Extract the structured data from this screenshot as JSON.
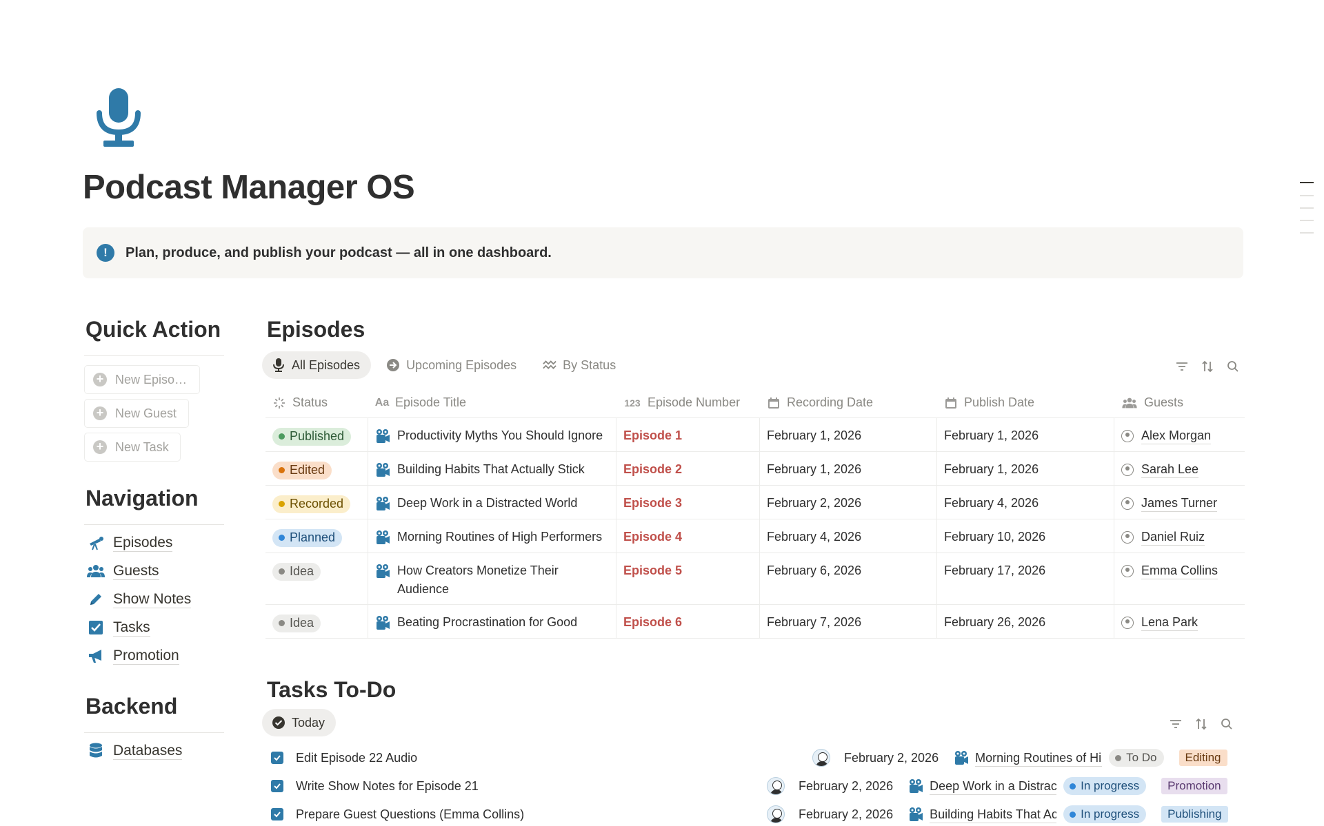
{
  "page": {
    "icon": "microphone-icon",
    "title": "Podcast Manager OS",
    "callout": "Plan, produce, and publish your podcast — all in one dashboard.",
    "callout_icon": "exclamation-bubble-icon"
  },
  "sidebar": {
    "quick_action_title": "Quick Action",
    "quick_actions": [
      {
        "label": "New Episo…",
        "icon": "plus-circle-icon"
      },
      {
        "label": "New Guest",
        "icon": "plus-circle-icon"
      },
      {
        "label": "New Task",
        "icon": "plus-circle-icon"
      }
    ],
    "navigation_title": "Navigation",
    "navigation": [
      {
        "label": "Episodes",
        "icon": "telescope-icon"
      },
      {
        "label": "Guests",
        "icon": "people-icon"
      },
      {
        "label": "Show Notes",
        "icon": "pencil-icon"
      },
      {
        "label": "Tasks",
        "icon": "checkbox-icon"
      },
      {
        "label": "Promotion",
        "icon": "megaphone-icon"
      }
    ],
    "backend_title": "Backend",
    "backend": [
      {
        "label": "Databases",
        "icon": "database-icon"
      }
    ]
  },
  "episodes": {
    "title": "Episodes",
    "tabs": [
      {
        "label": "All Episodes",
        "icon": "microphone-icon",
        "active": true
      },
      {
        "label": "Upcoming Episodes",
        "icon": "arrow-circle-icon",
        "active": false
      },
      {
        "label": "By Status",
        "icon": "waves-icon",
        "active": false
      }
    ],
    "columns": [
      {
        "label": "Status",
        "icon": "status-icon"
      },
      {
        "label": "Episode Title",
        "icon": "text-icon"
      },
      {
        "label": "Episode Number",
        "icon": "number-icon"
      },
      {
        "label": "Recording Date",
        "icon": "calendar-icon"
      },
      {
        "label": "Publish Date",
        "icon": "calendar-icon"
      },
      {
        "label": "Guests",
        "icon": "people-icon"
      }
    ],
    "header_glyphs": {
      "text": "Aa",
      "number": "123"
    },
    "rows": [
      {
        "status": "Published",
        "title": "Productivity Myths You Should Ignore",
        "number": "Episode 1",
        "recording": "February 1, 2026",
        "publish": "February 1, 2026",
        "guest": "Alex Morgan"
      },
      {
        "status": "Edited",
        "title": "Building Habits That Actually Stick",
        "number": "Episode 2",
        "recording": "February 1, 2026",
        "publish": "February 1, 2026",
        "guest": "Sarah Lee"
      },
      {
        "status": "Recorded",
        "title": "Deep Work in a Distracted World",
        "number": "Episode 3",
        "recording": "February 2, 2026",
        "publish": "February 4, 2026",
        "guest": "James Turner"
      },
      {
        "status": "Planned",
        "title": "Morning Routines of High Performers",
        "number": "Episode 4",
        "recording": "February 4, 2026",
        "publish": "February 10, 2026",
        "guest": "Daniel Ruiz"
      },
      {
        "status": "Idea",
        "title": "How Creators Monetize Their Audience",
        "number": "Episode 5",
        "recording": "February 6, 2026",
        "publish": "February 17, 2026",
        "guest": "Emma Collins"
      },
      {
        "status": "Idea",
        "title": "Beating Procrastination for Good",
        "number": "Episode 6",
        "recording": "February 7, 2026",
        "publish": "February 26, 2026",
        "guest": "Lena Park"
      }
    ]
  },
  "status_colors": {
    "Published": {
      "bg": "#dbeddb",
      "dot": "#4b9b5e",
      "text": "#2d5a36"
    },
    "Edited": {
      "bg": "#fadec9",
      "dot": "#d9730d",
      "text": "#6a3b12"
    },
    "Recorded": {
      "bg": "#fbeecb",
      "dot": "#d9a300",
      "text": "#6b4f00"
    },
    "Planned": {
      "bg": "#d3e5f5",
      "dot": "#2f86d8",
      "text": "#1e4f7a"
    },
    "Idea": {
      "bg": "#ececea",
      "dot": "#8a8984",
      "text": "#555450"
    }
  },
  "tasks": {
    "title": "Tasks To-Do",
    "view_tab": {
      "label": "Today",
      "icon": "check-circle-icon"
    },
    "rows": [
      {
        "name": "Edit Episode 22 Audio",
        "date": "February 2, 2026",
        "project": "Morning Routines of Hi",
        "status": "To Do",
        "tag": "Editing"
      },
      {
        "name": "Write Show Notes for Episode 21",
        "date": "February 2, 2026",
        "project": "Deep Work in a Distrac",
        "status": "In progress",
        "tag": "Promotion"
      },
      {
        "name": "Prepare Guest Questions (Emma Collins)",
        "date": "February 2, 2026",
        "project": "Building Habits That Ac",
        "status": "In progress",
        "tag": "Publishing"
      }
    ]
  },
  "task_status_colors": {
    "To Do": {
      "bg": "#ececea",
      "dot": "#8a8984",
      "text": "#555450"
    },
    "In progress": {
      "bg": "#d3e5f5",
      "dot": "#2f86d8",
      "text": "#1e4f7a"
    }
  },
  "tag_colors": {
    "Editing": {
      "bg": "#fadec9",
      "text": "#6a3b12"
    },
    "Promotion": {
      "bg": "#e8deee",
      "text": "#5a3a70"
    },
    "Publishing": {
      "bg": "#d3e5f5",
      "text": "#1e4f7a"
    }
  },
  "accent": "#2f7aa8"
}
